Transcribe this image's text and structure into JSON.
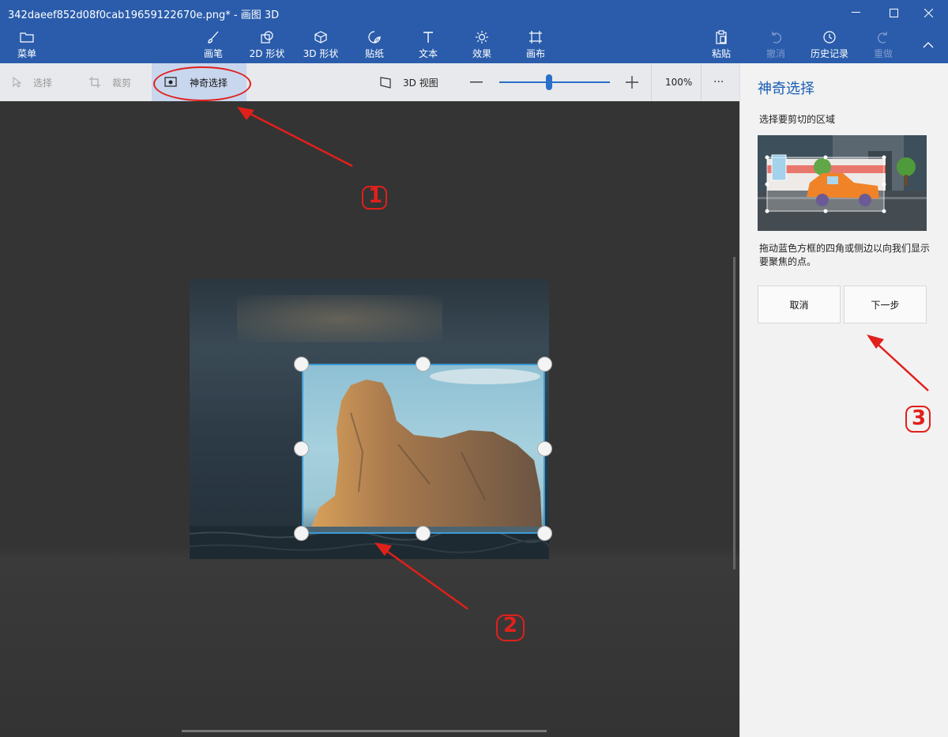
{
  "window": {
    "title": "342daeef852d08f0cab19659122670e.png* - 画图 3D",
    "min_icon": "minimize-icon",
    "max_icon": "maximize-icon",
    "close_icon": "close-icon"
  },
  "ribbon": {
    "menu": "菜单",
    "brushes": "画笔",
    "shapes2d": "2D 形状",
    "shapes3d": "3D 形状",
    "stickers": "贴纸",
    "text": "文本",
    "effects": "效果",
    "canvas": "画布",
    "paste": "粘贴",
    "undo": "撤消",
    "history": "历史记录",
    "redo": "重做"
  },
  "subbar": {
    "select": "选择",
    "crop": "裁剪",
    "magic_select": "神奇选择",
    "view3d": "3D 视图",
    "zoom": "100%",
    "zoom_level": 0.45,
    "more": "···"
  },
  "panel": {
    "title": "神奇选择",
    "subtitle": "选择要剪切的区域",
    "description": "拖动蓝色方框的四角或侧边以向我们显示要聚焦的点。",
    "cancel": "取消",
    "next": "下一步"
  },
  "annotations": {
    "one": "1",
    "two": "2",
    "three": "3"
  },
  "colors": {
    "ribbon": "#2a5cab",
    "accent": "#1a5fb4",
    "annotation": "#e0201b",
    "selection": "#3a9bd8"
  }
}
